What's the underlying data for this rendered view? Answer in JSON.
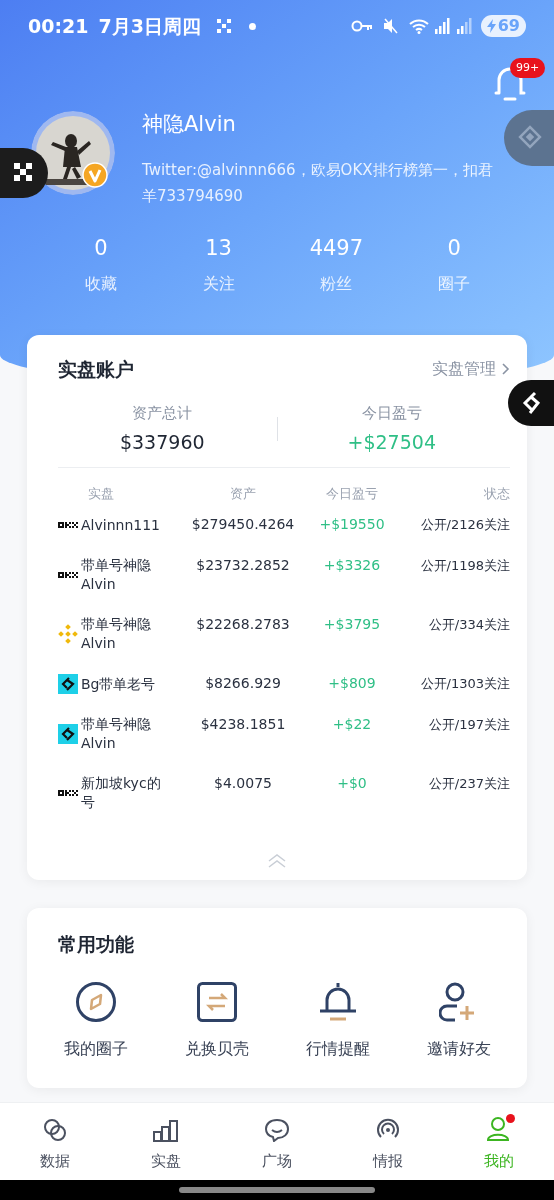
{
  "status_bar": {
    "time": "00:21",
    "date": "7月3日周四",
    "battery": "69"
  },
  "notifications": {
    "badge": "99+"
  },
  "profile": {
    "name": "神隐Alvin",
    "bio": "Twitter:@alvinnn666，欧易OKX排行榜第一，扣君羊733794690",
    "verified": true
  },
  "stats": [
    {
      "value": "0",
      "label": "收藏"
    },
    {
      "value": "13",
      "label": "关注"
    },
    {
      "value": "4497",
      "label": "粉丝"
    },
    {
      "value": "0",
      "label": "圈子"
    }
  ],
  "account_card": {
    "title": "实盘账户",
    "manage_link": "实盘管理",
    "summary": [
      {
        "label": "资产总计",
        "value": "$337960",
        "kind": "plain"
      },
      {
        "label": "今日盈亏",
        "value": "+$27504",
        "kind": "profit"
      }
    ],
    "columns": [
      "实盘",
      "资产",
      "今日盈亏",
      "状态"
    ],
    "rows": [
      {
        "kind": "okx",
        "name": "Alvinnn111",
        "assets": "$279450.4264",
        "pnl": "+$19550",
        "status": "公开/2126关注"
      },
      {
        "kind": "okx",
        "name": "带单号神隐Alvin",
        "assets": "$23732.2852",
        "pnl": "+$3326",
        "status": "公开/1198关注"
      },
      {
        "kind": "binance",
        "name": "带单号神隐Alvin",
        "assets": "$22268.2783",
        "pnl": "+$3795",
        "status": "公开/334关注"
      },
      {
        "kind": "bitget",
        "name": "Bg带单老号",
        "assets": "$8266.929",
        "pnl": "+$809",
        "status": "公开/1303关注"
      },
      {
        "kind": "bitget",
        "name": "带单号神隐Alvin",
        "assets": "$4238.1851",
        "pnl": "+$22",
        "status": "公开/197关注"
      },
      {
        "kind": "okx",
        "name": "新加坡kyc的号",
        "assets": "$4.0075",
        "pnl": "+$0",
        "status": "公开/237关注"
      }
    ]
  },
  "features": {
    "title": "常用功能",
    "items": [
      {
        "label": "我的圈子"
      },
      {
        "label": "兑换贝壳"
      },
      {
        "label": "行情提醒"
      },
      {
        "label": "邀请好友"
      }
    ]
  },
  "bottom_nav": [
    {
      "label": "数据",
      "selected": false,
      "dot": false
    },
    {
      "label": "实盘",
      "selected": false,
      "dot": false
    },
    {
      "label": "广场",
      "selected": false,
      "dot": false
    },
    {
      "label": "情报",
      "selected": false,
      "dot": false
    },
    {
      "label": "我的",
      "selected": true,
      "dot": true
    }
  ]
}
